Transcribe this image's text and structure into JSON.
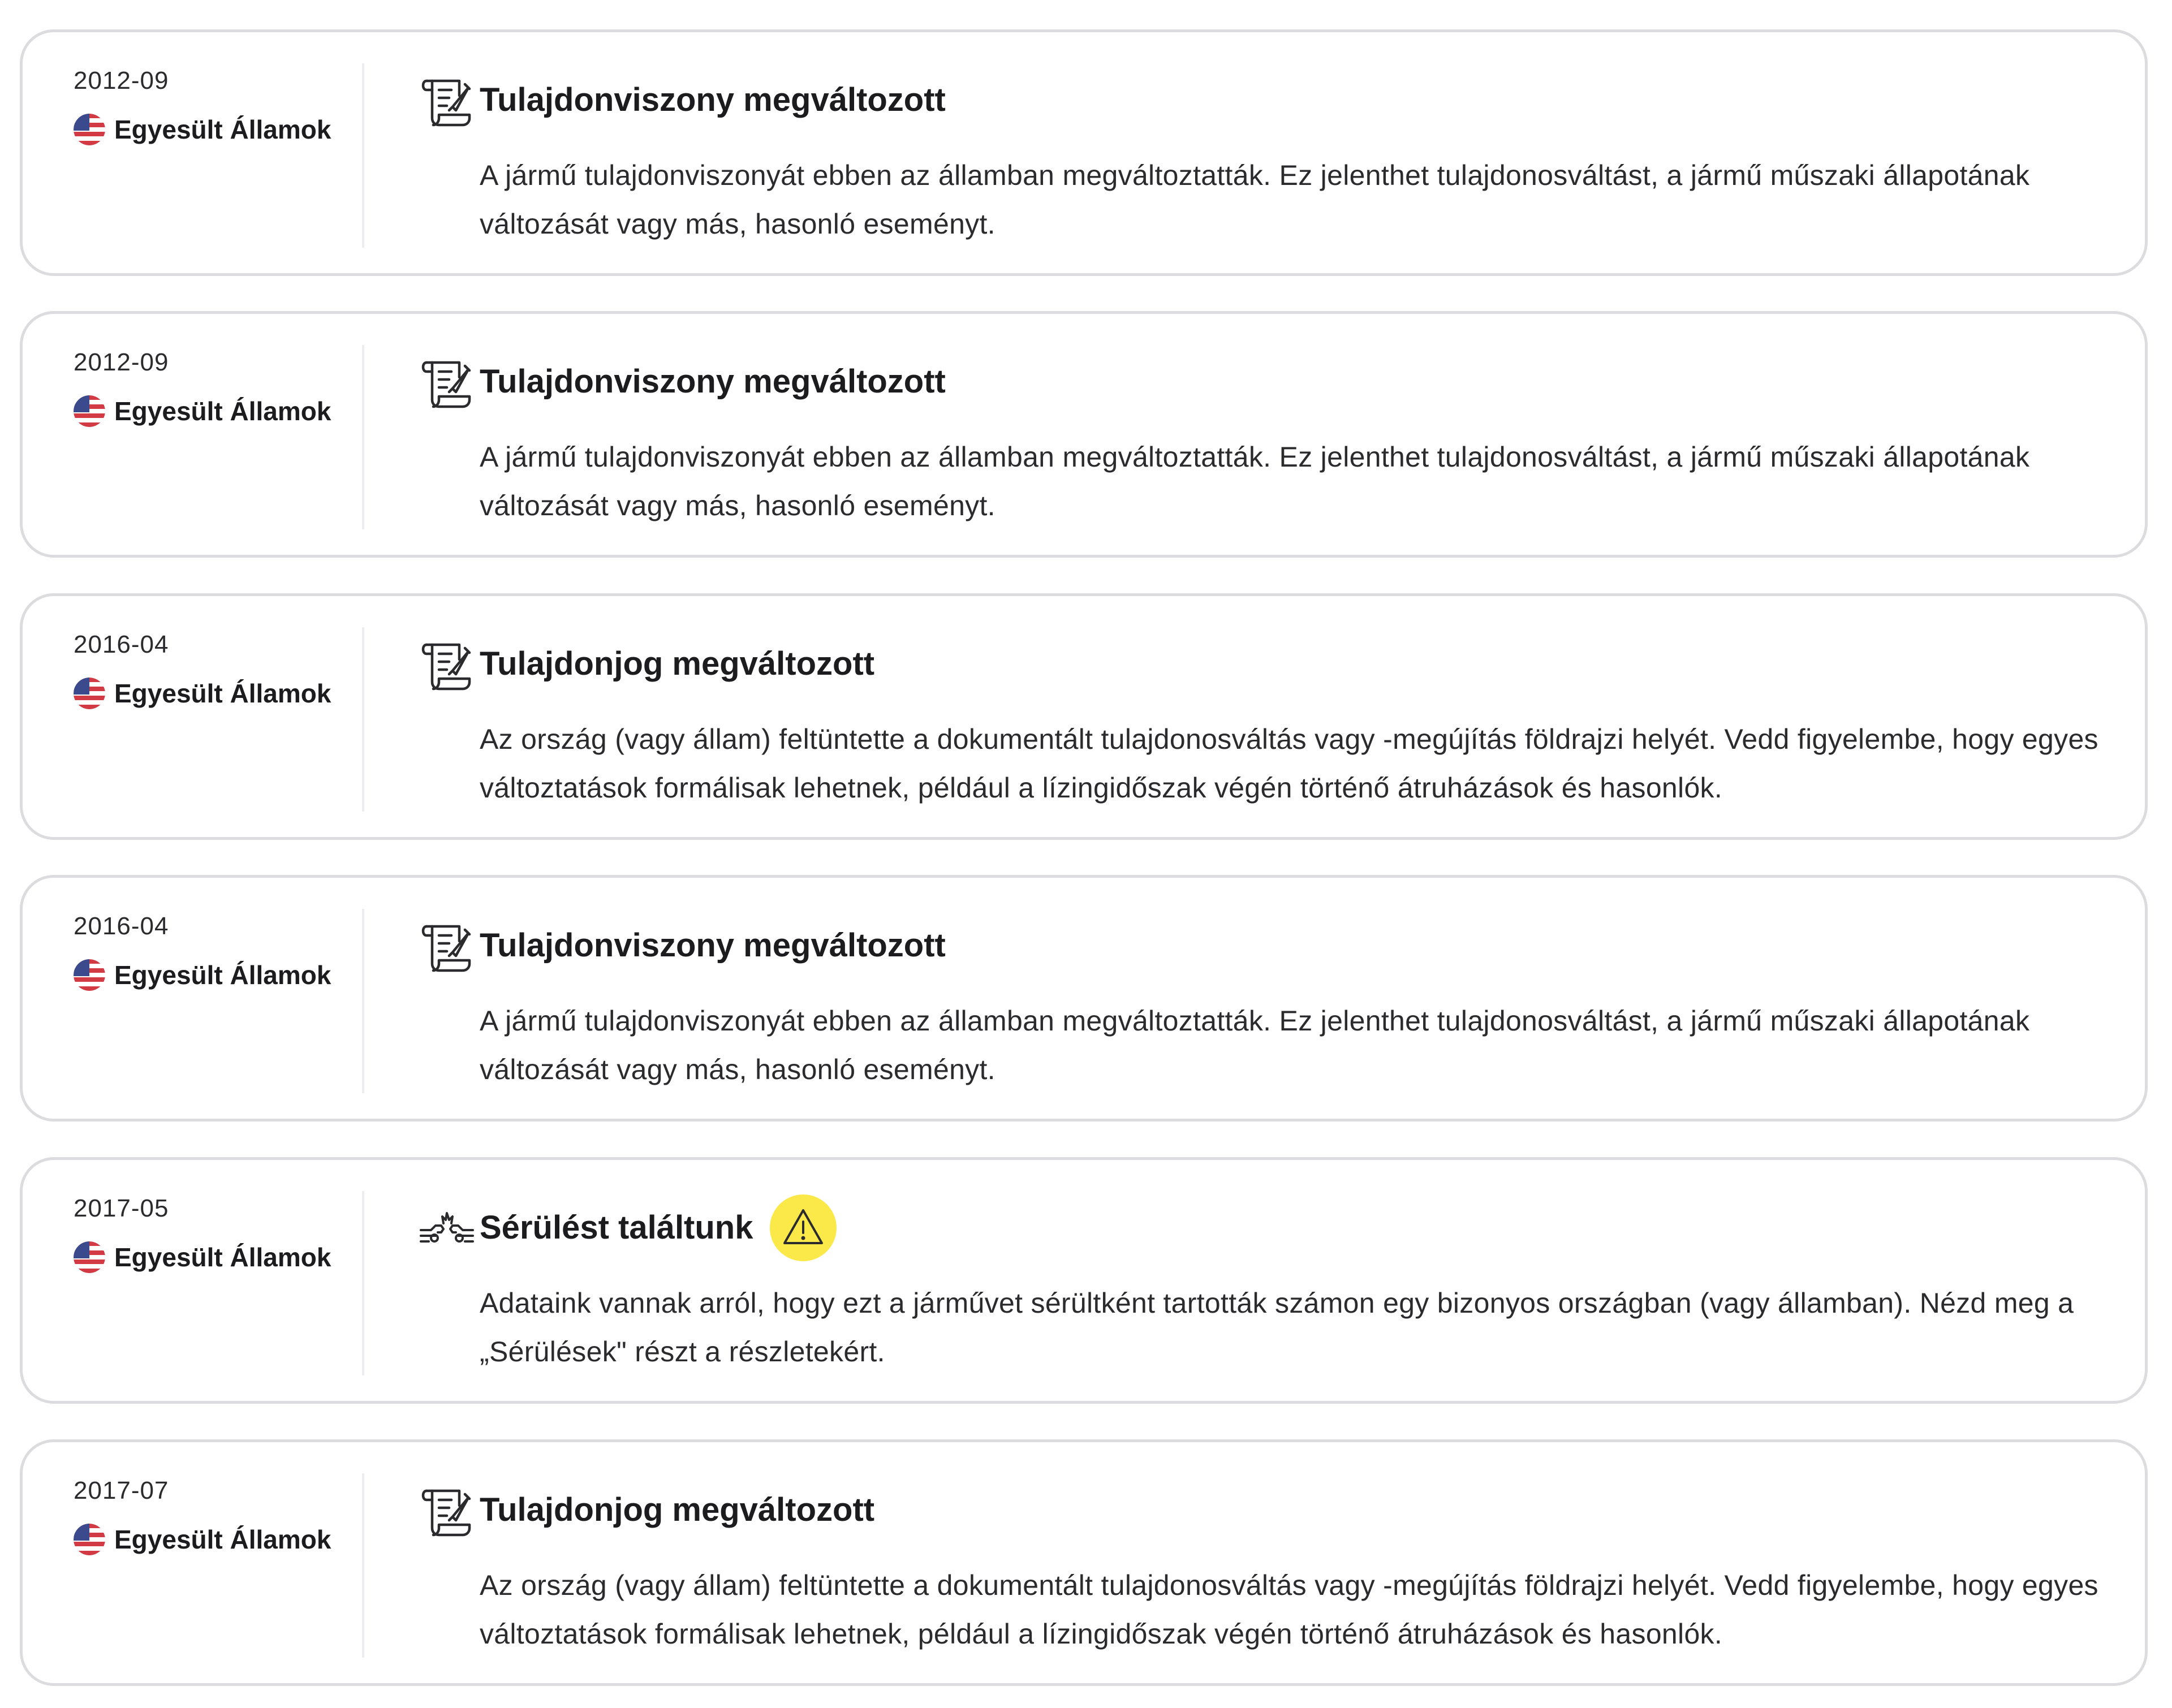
{
  "events": [
    {
      "date": "2012-09",
      "country": "Egyesült Államok",
      "flag_icon": "us-flag-icon",
      "icon": "document-edit-icon",
      "title": "Tulajdonviszony megváltozott",
      "description": "A jármű tulajdonviszonyát ebben az államban megváltoztatták. Ez jelenthet tulajdonosváltást, a jármű műszaki állapotának változását vagy más, hasonló eseményt."
    },
    {
      "date": "2012-09",
      "country": "Egyesült Államok",
      "flag_icon": "us-flag-icon",
      "icon": "document-edit-icon",
      "title": "Tulajdonviszony megváltozott",
      "description": "A jármű tulajdonviszonyát ebben az államban megváltoztatták. Ez jelenthet tulajdonosváltást, a jármű műszaki állapotának változását vagy más, hasonló eseményt."
    },
    {
      "date": "2016-04",
      "country": "Egyesült Államok",
      "flag_icon": "us-flag-icon",
      "icon": "document-edit-icon",
      "title": "Tulajdonjog megváltozott",
      "description": "Az ország (vagy állam) feltüntette a dokumentált tulajdonosváltás vagy -megújítás földrajzi helyét. Vedd figyelembe, hogy egyes változtatások formálisak lehetnek, például a lízingidőszak végén történő átruházások és hasonlók."
    },
    {
      "date": "2016-04",
      "country": "Egyesült Államok",
      "flag_icon": "us-flag-icon",
      "icon": "document-edit-icon",
      "title": "Tulajdonviszony megváltozott",
      "description": "A jármű tulajdonviszonyát ebben az államban megváltoztatták. Ez jelenthet tulajdonosváltást, a jármű műszaki állapotának változását vagy más, hasonló eseményt."
    },
    {
      "date": "2017-05",
      "country": "Egyesült Államok",
      "flag_icon": "us-flag-icon",
      "icon": "car-crash-icon",
      "title": "Sérülést találtunk",
      "badge_icon": "warning-icon",
      "badge_color": "#fbe94a",
      "description": "Adataink vannak arról, hogy ezt a járművet sérültként tartották számon egy bizonyos országban (vagy államban). Nézd meg a „Sérülések\" részt a részletekért."
    },
    {
      "date": "2017-07",
      "country": "Egyesült Államok",
      "flag_icon": "us-flag-icon",
      "icon": "document-edit-icon",
      "title": "Tulajdonjog megváltozott",
      "description": "Az ország (vagy állam) feltüntette a dokumentált tulajdonosváltás vagy -megújítás földrajzi helyét. Vedd figyelembe, hogy egyes változtatások formálisak lehetnek, például a lízingidőszak végén történő átruházások és hasonlók."
    }
  ]
}
